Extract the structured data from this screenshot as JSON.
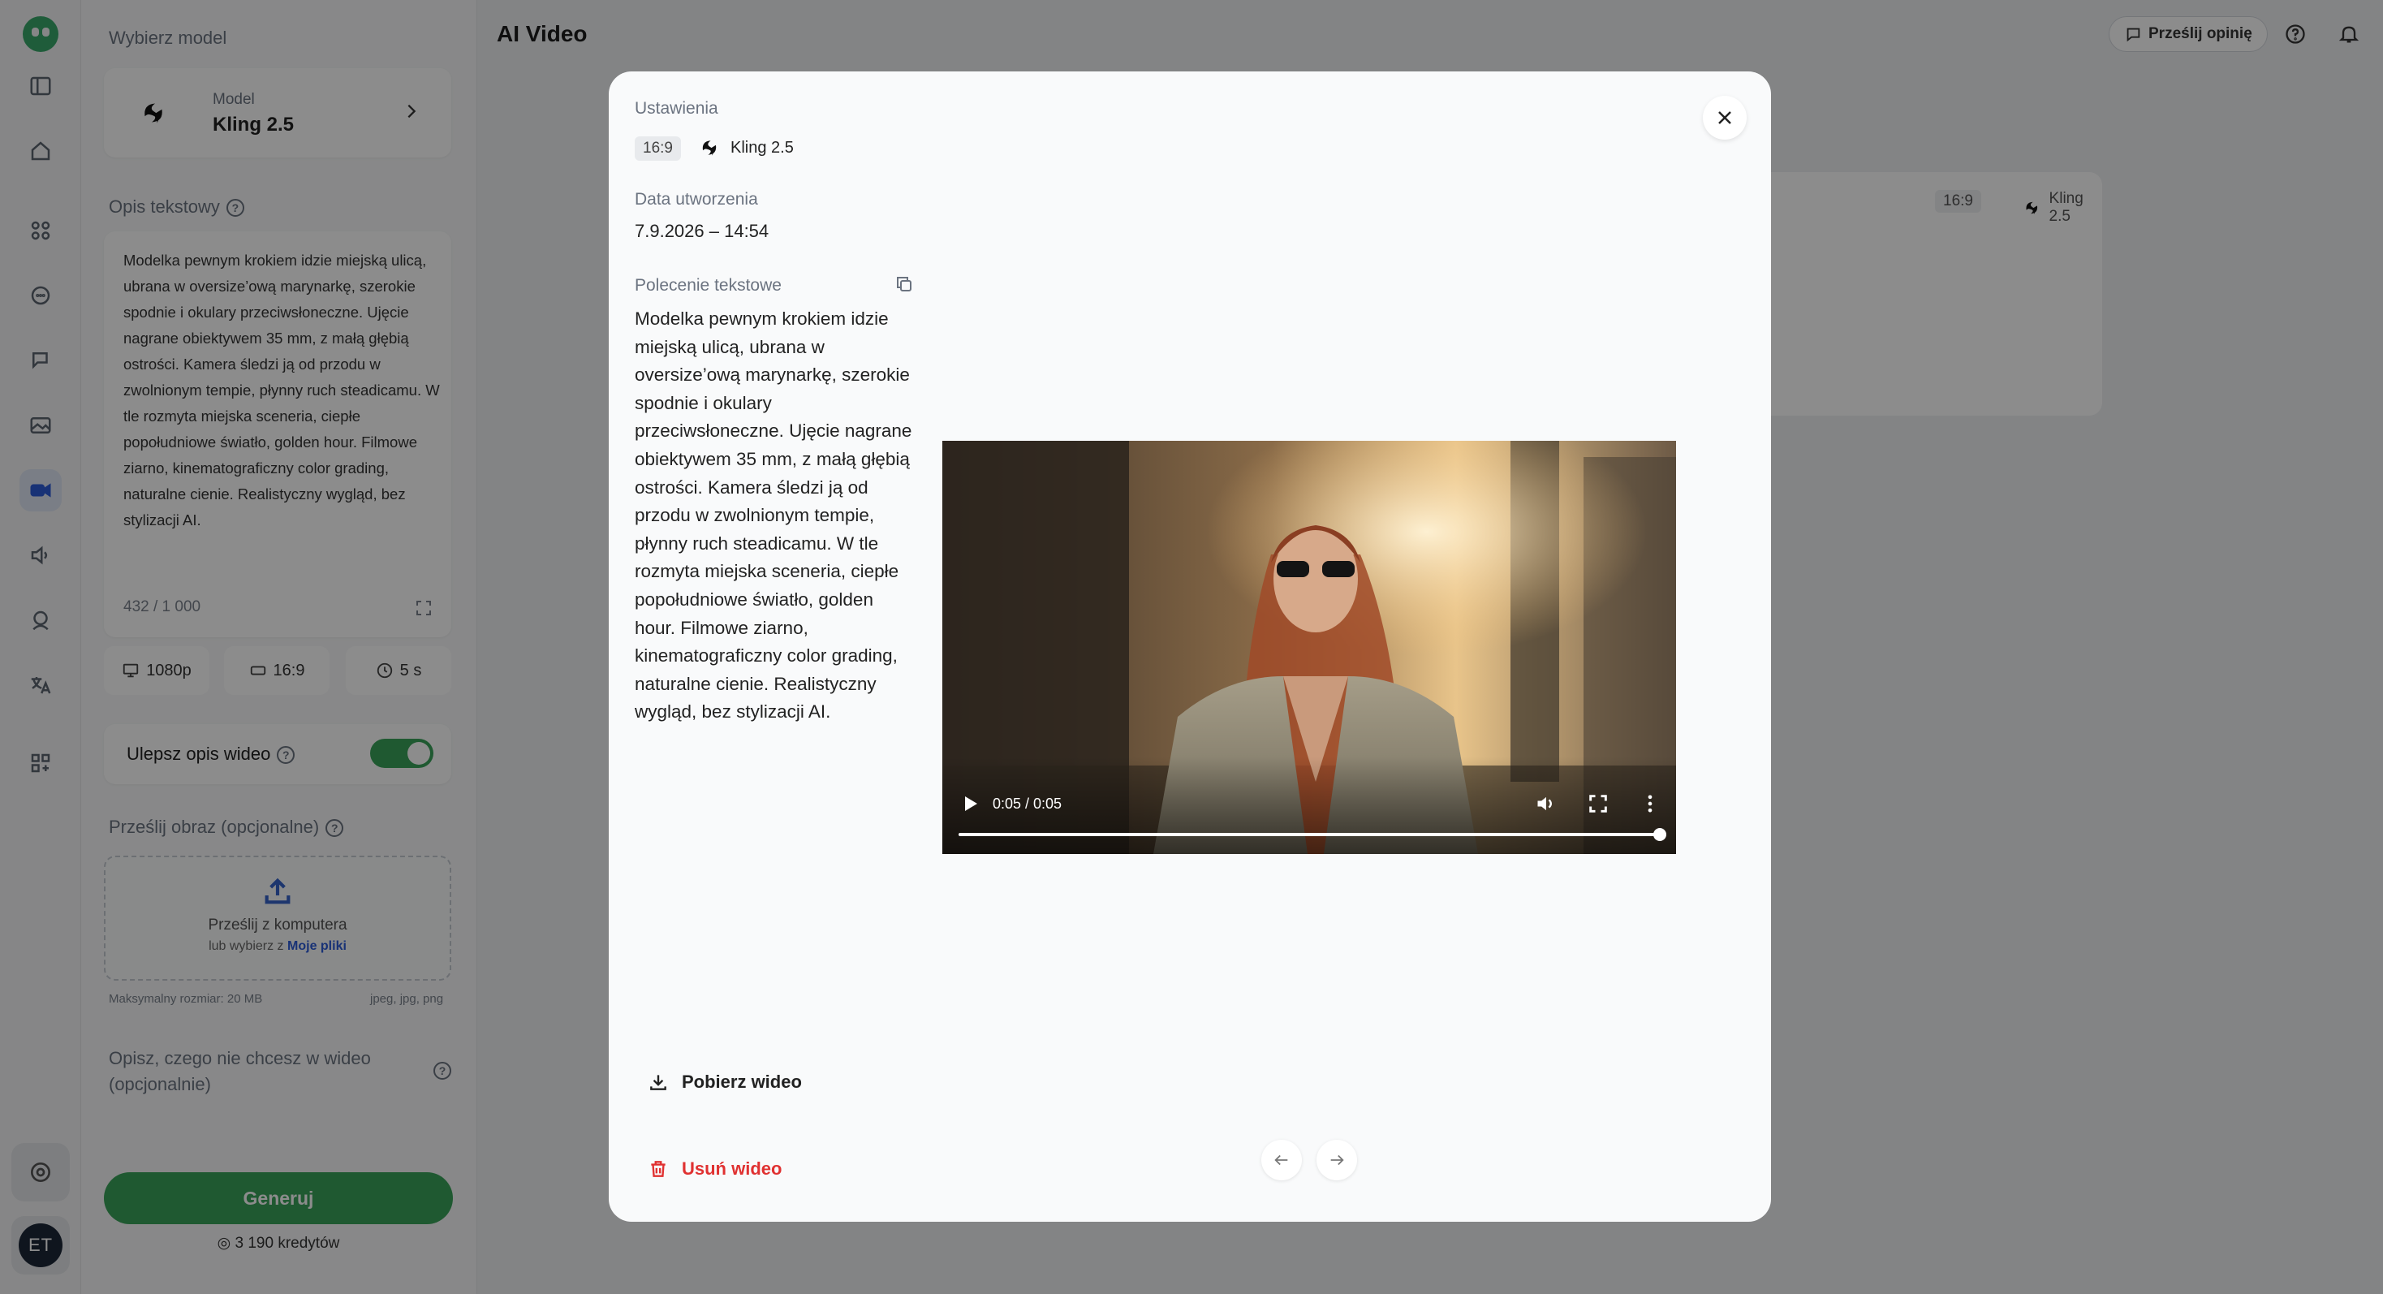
{
  "app": {
    "title": "AI Video"
  },
  "header": {
    "feedback_label": "Prześlij opinię"
  },
  "panel": {
    "select_model_label": "Wybierz model",
    "model": {
      "sub_label": "Model",
      "name": "Kling 2.5"
    },
    "text_desc_label": "Opis tekstowy",
    "description": "Modelka pewnym krokiem idzie miejską ulicą, ubrana w oversize’ową marynarkę, szerokie spodnie i okulary przeciwsłoneczne. Ujęcie nagrane obiektywem 35 mm, z małą głębią ostrości. Kamera śledzi ją od przodu w zwolnionym tempie, płynny ruch steadicamu. W tle rozmyta miejska sceneria, ciepłe popołudniowe światło, golden hour. Filmowe ziarno, kinematograficzny color grading, naturalne cienie. Realistyczny wygląd, bez stylizacji AI.",
    "char_count": "432 / 1 000",
    "options": {
      "resolution": "1080p",
      "ratio": "16:9",
      "duration": "5 s"
    },
    "enhance_label": "Ulepsz opis wideo",
    "enhance_on": true,
    "upload_label": "Prześlij obraz (opcjonalne)",
    "upload_main": "Prześlij z komputera",
    "upload_sub_prefix": "lub wybierz z",
    "upload_sub_link": "Moje pliki",
    "max_size": "Maksymalny rozmiar: 20 MB",
    "formats": "jpeg, jpg, png",
    "negative_label": "Opisz, czego nie chcesz w wideo (opcjonalnie)",
    "generate_label": "Generuj",
    "credits": "3 190 kredytów"
  },
  "result_card": {
    "ratio": "16:9",
    "model": "Kling 2.5"
  },
  "user": {
    "initials": "ET"
  },
  "modal": {
    "settings_label": "Ustawienia",
    "ratio": "16:9",
    "model": "Kling 2.5",
    "created_label": "Data utworzenia",
    "created_value": "7.9.2026 – 14:54",
    "prompt_label": "Polecenie tekstowe",
    "prompt": "Modelka pewnym krokiem idzie miejską ulicą, ubrana w oversize’ową marynarkę, szerokie spodnie i okulary przeciwsłoneczne. Ujęcie nagrane obiektywem 35 mm, z małą głębią ostrości. Kamera śledzi ją od przodu w zwolnionym tempie, płynny ruch steadicamu. W tle rozmyta miejska sceneria, ciepłe popołudniowe światło, golden hour. Filmowe ziarno, kinematograficzny color grading, naturalne cienie. Realistyczny wygląd, bez stylizacji AI.",
    "video": {
      "time": "0:05 / 0:05",
      "progress": 1.0
    },
    "download_label": "Pobierz wideo",
    "delete_label": "Usuń wideo"
  },
  "colors": {
    "accent_green": "#3aa25a",
    "accent_blue": "#2d5bd7",
    "danger": "#e03131"
  }
}
